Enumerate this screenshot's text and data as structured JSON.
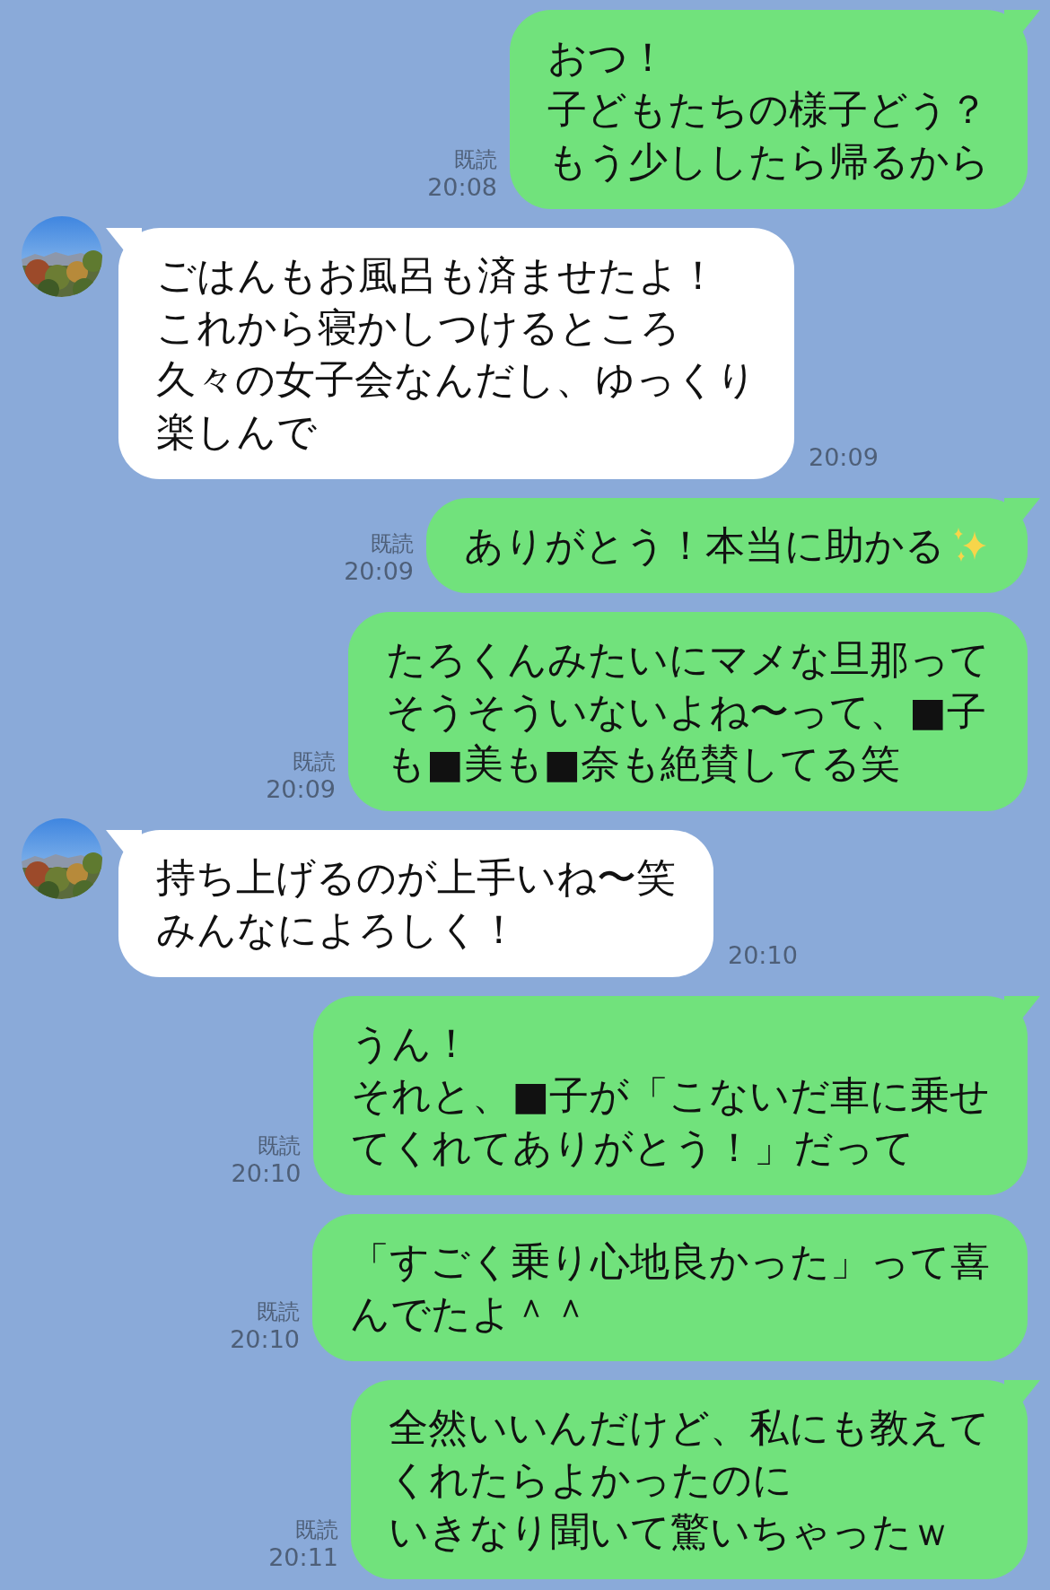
{
  "messages": [
    {
      "kind": "sent",
      "tail": true,
      "lines": [
        "おつ！",
        "子どもたちの様子どう？",
        "もう少ししたら帰るから"
      ],
      "read": "既読",
      "time": "20:08"
    },
    {
      "kind": "received",
      "tail": true,
      "avatar": {
        "kind": "picture"
      },
      "lines": [
        "ごはんもお風呂も済ませたよ！",
        "これから寝かしつけるところ",
        "久々の女子会なんだし、ゆっくり",
        "楽しんで"
      ],
      "time": "20:09"
    },
    {
      "kind": "sent",
      "tail": true,
      "lines": [
        "ありがとう！本当に助かる"
      ],
      "icon": true,
      "read": "既読",
      "time": "20:09"
    },
    {
      "kind": "sent",
      "tail": false,
      "lines": [
        "たろくんみたいにマメな旦那って",
        "そうそういないよね〜って、■子",
        "も■美も■奈も絶賛してる笑"
      ],
      "read": "既読",
      "time": "20:09"
    },
    {
      "kind": "received",
      "tail": true,
      "avatar": {
        "kind": "picture"
      },
      "lines": [
        "持ち上げるのが上手いね〜笑",
        "みんなによろしく！"
      ],
      "time": "20:10"
    },
    {
      "kind": "sent",
      "tail": true,
      "lines": [
        "うん！",
        "それと、■子が「こないだ車に乗せ",
        "てくれてありがとう！」だって"
      ],
      "read": "既読",
      "time": "20:10"
    },
    {
      "kind": "sent",
      "tail": false,
      "lines": [
        "「すごく乗り心地良かった」って喜",
        "んでたよ＾＾"
      ],
      "read": "既読",
      "time": "20:10"
    },
    {
      "kind": "sent",
      "tail": true,
      "lines": [
        "全然いいんだけど、私にも教えて",
        "くれたらよかったのに",
        "いきなり聞いて驚いちゃったｗ"
      ],
      "read": "既読",
      "time": "20:11"
    }
  ]
}
